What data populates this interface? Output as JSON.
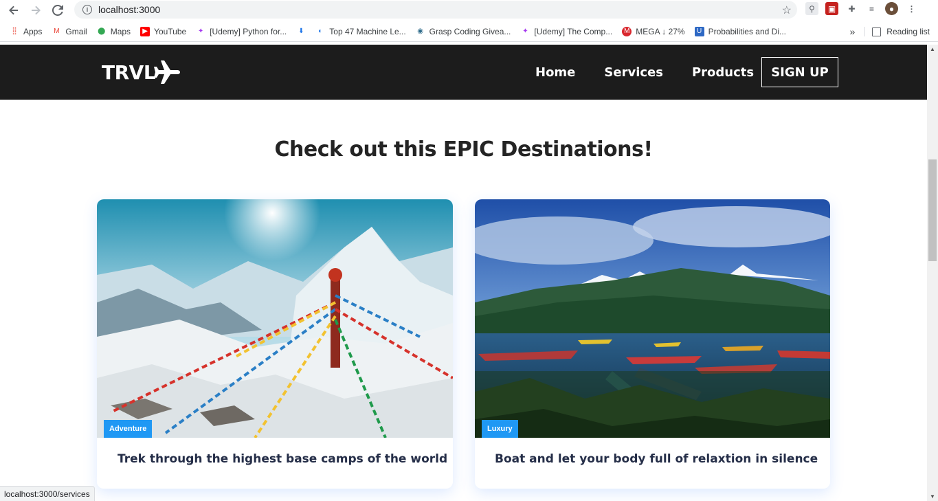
{
  "browser": {
    "url": "localhost:3000",
    "status_url": "localhost:3000/services",
    "bookmarks": [
      {
        "label": "Apps",
        "icon": "apps-grid-icon",
        "color": "#ea4335"
      },
      {
        "label": "Gmail",
        "icon": "gmail-icon",
        "color": "#ea4335"
      },
      {
        "label": "Maps",
        "icon": "maps-pin-icon",
        "color": "#34a853"
      },
      {
        "label": "YouTube",
        "icon": "youtube-icon",
        "color": "#ff0000"
      },
      {
        "label": "[Udemy] Python for...",
        "icon": "udemy-icon",
        "color": "#a435f0"
      },
      {
        "label": "",
        "icon": "download-icon",
        "color": "#1a73e8"
      },
      {
        "label": "Top 47 Machine Le...",
        "icon": "edge-icon",
        "color": "#1a73e8"
      },
      {
        "label": "Grasp Coding Givea...",
        "icon": "grasp-icon",
        "color": "#2e6b8a"
      },
      {
        "label": "[Udemy] The Comp...",
        "icon": "udemy-icon",
        "color": "#a435f0"
      },
      {
        "label": "MEGA ↓ 27%",
        "icon": "mega-icon",
        "color": "#d9272e"
      },
      {
        "label": "Probabilities and Di...",
        "icon": "ucla-icon",
        "color": "#2d68c4"
      }
    ],
    "more_label": "»",
    "reading_list": "Reading list"
  },
  "navbar": {
    "logo": "TRVL",
    "links": [
      "Home",
      "Services",
      "Products"
    ],
    "signup": "SIGN UP"
  },
  "main": {
    "heading": "Check out this EPIC Destinations!",
    "cards": [
      {
        "tag": "Adventure",
        "text": "Trek through the highest base camps of the world"
      },
      {
        "tag": "Luxury",
        "text": "Boat and let your body full of relaxtion in silence"
      }
    ]
  },
  "colors": {
    "navbar_bg": "#1c1c1c",
    "tag_bg": "#1f98f4",
    "card_text": "#252e48"
  }
}
